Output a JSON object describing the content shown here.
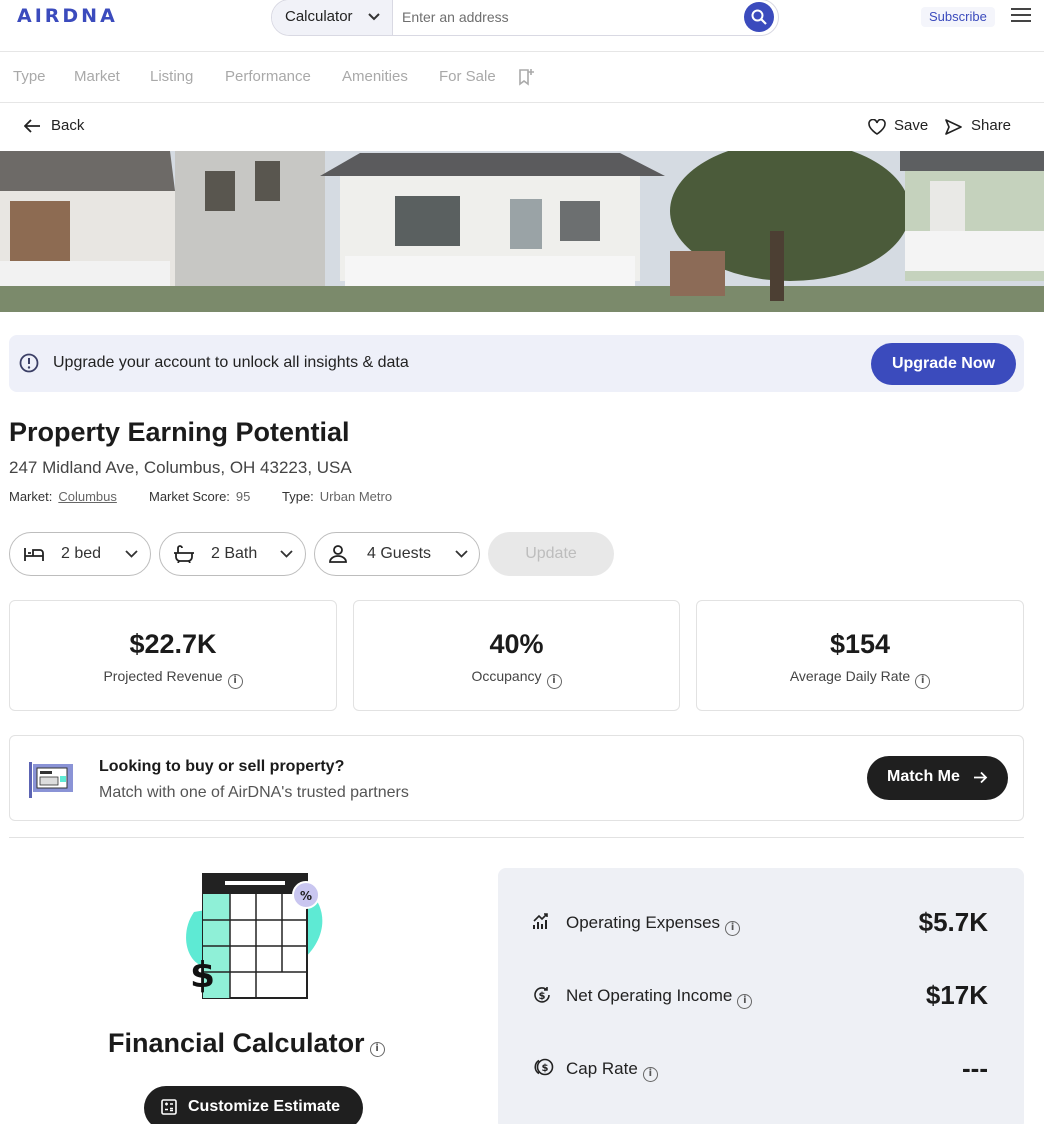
{
  "header": {
    "logo": "AIRDNA",
    "search_mode": "Calculator",
    "search_placeholder": "Enter an address",
    "subscribe": "Subscribe"
  },
  "nav": {
    "tabs": [
      "Type",
      "Market",
      "Listing",
      "Performance",
      "Amenities",
      "For Sale"
    ]
  },
  "actions": {
    "back": "Back",
    "save": "Save",
    "share": "Share"
  },
  "upgrade": {
    "text": "Upgrade your account to unlock all insights & data",
    "button": "Upgrade Now"
  },
  "property": {
    "title": "Property Earning Potential",
    "address": "247 Midland Ave, Columbus, OH 43223, USA",
    "market_label": "Market:",
    "market_value": "Columbus",
    "score_label": "Market Score:",
    "score_value": "95",
    "type_label": "Type:",
    "type_value": "Urban Metro"
  },
  "selectors": {
    "bed": "2 bed",
    "bath": "2 Bath",
    "guests": "4 Guests",
    "update": "Update"
  },
  "metrics": [
    {
      "value": "$22.7K",
      "label": "Projected Revenue"
    },
    {
      "value": "40%",
      "label": "Occupancy"
    },
    {
      "value": "$154",
      "label": "Average Daily Rate"
    }
  ],
  "partner": {
    "heading": "Looking to buy or sell property?",
    "subtext": "Match with one of AirDNA's trusted partners",
    "button": "Match Me"
  },
  "calculator": {
    "title": "Financial Calculator",
    "button": "Customize Estimate",
    "rows": [
      {
        "label": "Operating Expenses",
        "value": "$5.7K"
      },
      {
        "label": "Net Operating Income",
        "value": "$17K"
      },
      {
        "label": "Cap Rate",
        "value": "---"
      }
    ]
  },
  "colors": {
    "brand": "#3b4bbd",
    "dark_button": "#1f1f1f",
    "panel": "#eef0f5",
    "mint": "#5eead4"
  }
}
